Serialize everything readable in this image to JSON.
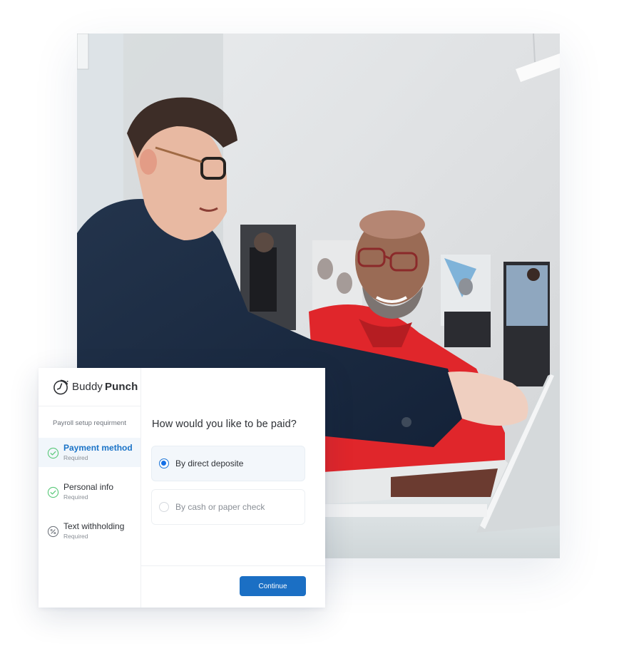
{
  "photo": {
    "description": "Two men smiling at a laptop in an office; one in navy blazer pointing, one in red shirt"
  },
  "card": {
    "brand": {
      "icon": "stopwatch-icon",
      "name_light": "Buddy",
      "name_bold": "Punch"
    },
    "sidebar": {
      "title": "Payroll setup requirment",
      "steps": [
        {
          "label": "Payment method",
          "sub": "Required",
          "icon": "check-circle-icon",
          "active": true
        },
        {
          "label": "Personal info",
          "sub": "Required",
          "icon": "check-circle-icon",
          "active": false
        },
        {
          "label": "Text withholding",
          "sub": "Required",
          "icon": "percent-circle-icon",
          "active": false
        }
      ]
    },
    "main": {
      "question": "How would you like to be paid?",
      "options": [
        {
          "label": "By direct deposite",
          "selected": true
        },
        {
          "label": "By cash or paper check",
          "selected": false
        }
      ],
      "continue_label": "Continue"
    }
  },
  "colors": {
    "accent": "#1b6fc4",
    "radio_selected": "#1570e6",
    "step_done": "#5cc97b",
    "active_step_bg": "#f1f6fb"
  }
}
